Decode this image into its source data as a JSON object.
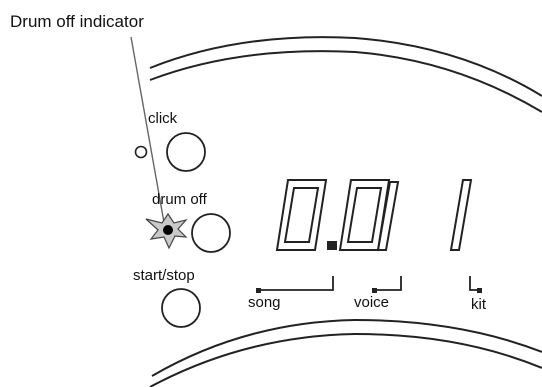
{
  "annotation": {
    "callout": "Drum off indicator"
  },
  "buttons": {
    "click_label": "click",
    "drum_off_label": "drum off",
    "start_stop_label": "start/stop"
  },
  "display": {
    "digits": [
      "0",
      ".",
      "0",
      "1",
      "1"
    ],
    "reading": "0.01 1"
  },
  "labels": {
    "song": "song",
    "voice": "voice",
    "kit": "kit"
  },
  "style": {
    "line_color": "#222222",
    "text_color": "#111111",
    "led_color": "#000000"
  }
}
